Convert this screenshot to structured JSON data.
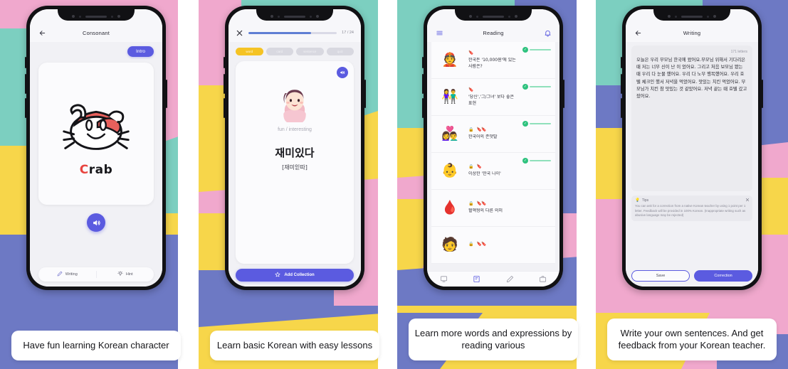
{
  "panels": [
    {
      "header": {
        "title": "Consonant",
        "back_icon": "arrow-left-icon"
      },
      "intro_label": "Intro",
      "card": {
        "word": "Crab",
        "word_highlight": "C",
        "word_rest": "rab",
        "image": "crab-illustration"
      },
      "speaker_icon": "speaker-icon",
      "bottom_bar": [
        {
          "label": "Writing",
          "icon": "pencil-icon"
        },
        {
          "label": "Hint",
          "icon": "lightbulb-icon"
        }
      ],
      "caption": "Have fun learning Korean character"
    },
    {
      "close_icon": "close-icon",
      "progress": {
        "current": 17,
        "total": 24,
        "text": "17 / 24",
        "percent": 71
      },
      "chips": [
        {
          "label": "word",
          "active": true
        },
        {
          "label": "card",
          "active": false
        },
        {
          "label": "sentence",
          "active": false
        },
        {
          "label": "quiz",
          "active": false
        }
      ],
      "card": {
        "audio_icon": "speaker-icon",
        "avatar": "girl-avatar",
        "meaning": "fun / interesting",
        "korean": "재미있다",
        "pronunciation": "[재미읻따]"
      },
      "add_collection_label": "Add Collection",
      "caption": "Learn basic Korean with easy lessons"
    },
    {
      "header": {
        "title": "Reading",
        "menu_icon": "hamburger-icon",
        "bell_icon": "bell-icon"
      },
      "rows": [
        {
          "thumb": "👲",
          "locked": false,
          "level": "🔖",
          "title": "한국돈 '10,000원'에 있는 사람은?",
          "done": true
        },
        {
          "thumb": "👫",
          "locked": false,
          "level": "🔖",
          "title": "'당신','그/그녀' 보다 좋은 표현",
          "done": true
        },
        {
          "thumb": "👩‍❤️‍👨",
          "locked": true,
          "level": "🔖🔖",
          "title": "한국어의 존댓말",
          "done": true
        },
        {
          "thumb": "👶",
          "locked": true,
          "level": "🔖",
          "title": "이상한 '한국 나이'",
          "done": true
        },
        {
          "thumb": "🩸",
          "locked": true,
          "level": "🔖🔖",
          "title": "혈액형의 다른 의미",
          "done": false
        },
        {
          "thumb": "🧑",
          "locked": true,
          "level": "🔖🔖",
          "title": "",
          "done": false
        }
      ],
      "nav": [
        {
          "icon": "monitor-icon",
          "active": false
        },
        {
          "icon": "feed-icon",
          "active": true
        },
        {
          "icon": "pencil-icon",
          "active": false
        },
        {
          "icon": "briefcase-icon",
          "active": false
        }
      ],
      "caption": "Learn more words and expressions by reading various"
    },
    {
      "header": {
        "title": "Writing",
        "back_icon": "arrow-left-icon"
      },
      "letter_count": "171 letters",
      "text": "오늘은 우리 부모님 한국에 왔어요.부모님 위해서 기다리은 때 저는 너무 신이 난 이 었어요. 그리고 처음 보모님 봤는 때 우리 다 눈물 했어요. 우리 다 노무 행복했어요. 우리 호텔 체크인 했서 저녁을 먹었어요. 맛있는 치킨 먹었어요. 부모님가 치킨 참 맛있는 것 같았어요. 저녁 끝는 때 호텔 갔고 잤어요.",
      "tips": {
        "title": "Tips",
        "icon": "lightbulb-icon",
        "close_icon": "close-icon",
        "body": "You can ask for a correction from a native Korean teacher by using 1 point per 1 letter. Feedback will be provided in 100% Korean. (Inappropriate writing such as abusive language may be rejected)"
      },
      "save_label": "Save",
      "correction_label": "Correction",
      "caption": "Write your own sentences. And get feedback from your Korean teacher."
    }
  ],
  "colors": {
    "accent_purple": "#5b5be0",
    "accent_yellow": "#f5c324",
    "bg_pink": "#f0a8cd",
    "bg_teal": "#7ccfc0",
    "bg_yellow": "#f7d64a",
    "bg_blue": "#6d79c4",
    "status_green": "#2ec27e"
  }
}
